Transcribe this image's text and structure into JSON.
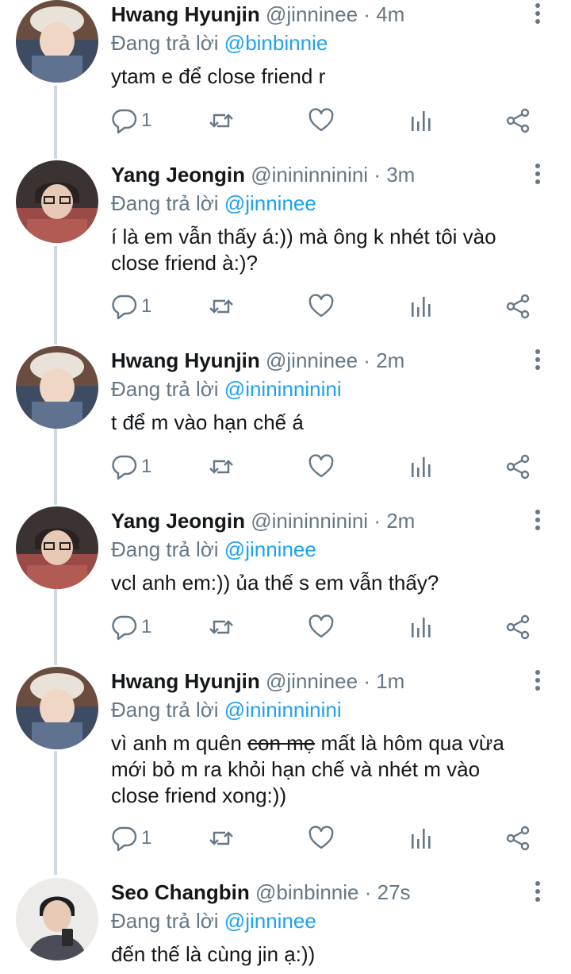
{
  "replying_prefix": "Đang trả lời",
  "tweets": [
    {
      "name": "Hwang Hyunjin",
      "handle": "@jinninee",
      "dot": "·",
      "time": "4m",
      "reply_to": "@binbinnie",
      "text_lines": [
        "ytam e để close friend r"
      ],
      "reply_count": "1",
      "avatar": "hyunjin"
    },
    {
      "name": "Yang Jeongin",
      "handle": "@inininninini",
      "dot": "·",
      "time": "3m",
      "reply_to": "@jinninee",
      "text_lines": [
        "í là em vẫn thấy á:)) mà ông k nhét tôi vào",
        "close friend à:)?"
      ],
      "reply_count": "1",
      "avatar": "jeongin"
    },
    {
      "name": "Hwang Hyunjin",
      "handle": "@jinninee",
      "dot": "·",
      "time": "2m",
      "reply_to": "@inininninini",
      "text_lines": [
        "t để m vào hạn chế á"
      ],
      "reply_count": "1",
      "avatar": "hyunjin"
    },
    {
      "name": "Yang Jeongin",
      "handle": "@inininninini",
      "dot": "·",
      "time": "2m",
      "reply_to": "@jinninee",
      "text_lines": [
        "vcl anh em:)) ủa thế s em vẫn thấy?"
      ],
      "reply_count": "1",
      "avatar": "jeongin"
    },
    {
      "name": "Hwang Hyunjin",
      "handle": "@jinninee",
      "dot": "·",
      "time": "1m",
      "reply_to": "@inininninini",
      "text_line1_pre": "vì anh m quên ",
      "text_line1_strike": "con mẹ",
      "text_line1_post": " mất là hôm qua vừa",
      "text_lines": [
        "mới bỏ m ra khỏi hạn chế và nhét m vào",
        "close friend xong:))"
      ],
      "reply_count": "1",
      "avatar": "hyunjin"
    },
    {
      "name": "Seo Changbin",
      "handle": "@binbinnie",
      "dot": "·",
      "time": "27s",
      "reply_to": "@jinninee",
      "text_lines": [
        "đến thế là cùng jin ạ:))"
      ],
      "avatar": "changbin"
    }
  ],
  "colors": {
    "text": "#14171a",
    "muted": "#657786",
    "mention": "#1da1f2",
    "thread": "#cfd9de"
  },
  "icons": [
    "reply-icon",
    "retweet-icon",
    "like-icon",
    "analytics-icon",
    "share-icon",
    "more-options-icon"
  ]
}
